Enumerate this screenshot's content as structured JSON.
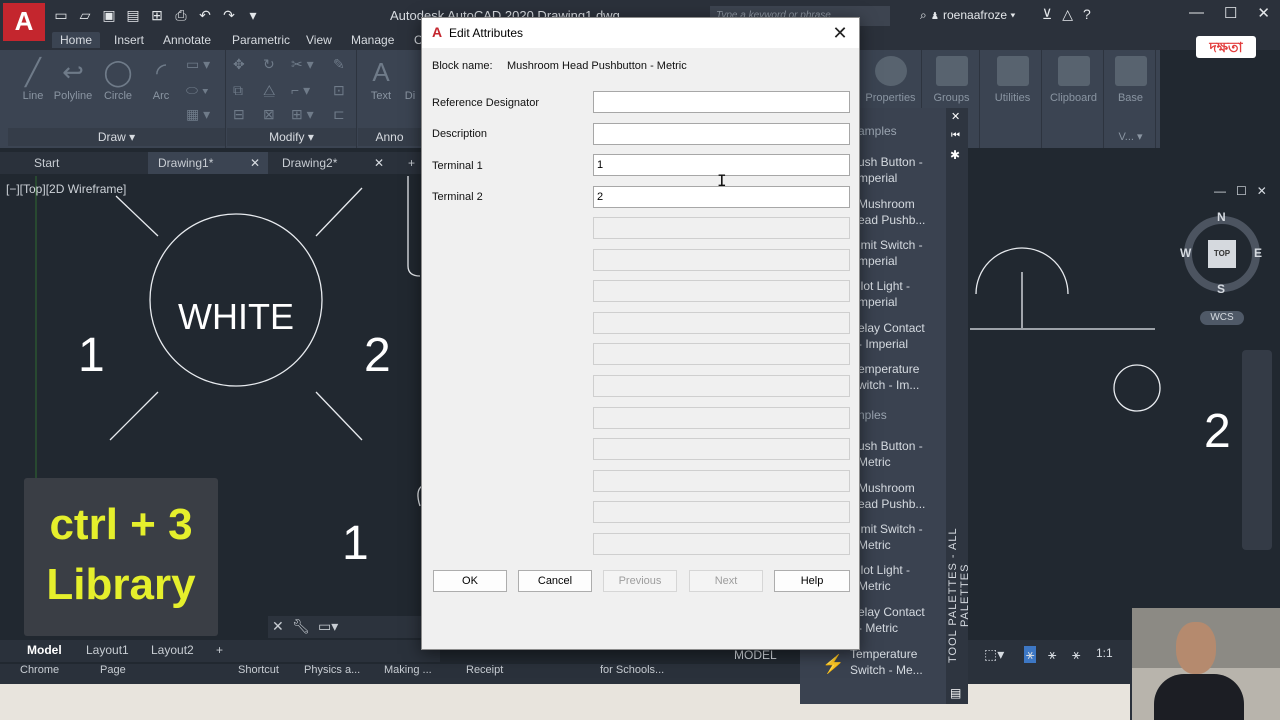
{
  "app": {
    "logo": "A",
    "title": "Autodesk AutoCAD 2020    Drawing1.dwg",
    "search_placeholder": "Type a keyword or phrase",
    "user": "roenaafroze",
    "qat_icons": [
      "new-icon",
      "open-icon",
      "save-icon",
      "saveas-icon",
      "web-icon",
      "print-icon",
      "undo-icon",
      "redo-icon",
      "more-icon"
    ]
  },
  "ribbon": {
    "tabs": [
      "Home",
      "Insert",
      "Annotate",
      "Parametric",
      "View",
      "Manage",
      "O"
    ],
    "active_tab": "Home",
    "draw_tools": [
      "Line",
      "Polyline",
      "Circle",
      "Arc"
    ],
    "draw_panel": "Draw ▾",
    "modify_panel": "Modify ▾",
    "text_tool": "Text",
    "text_tool2": "Di",
    "annotate_panel": "Anno",
    "right_panels": [
      "Properties",
      "Groups",
      "Utilities",
      "Clipboard",
      "Base"
    ],
    "view_label": "V... ▾"
  },
  "doc_tabs": [
    {
      "label": "Start"
    },
    {
      "label": "Drawing1*"
    },
    {
      "label": "Drawing2*"
    }
  ],
  "viewport": {
    "label": "[−][Top][2D Wireframe]",
    "circle_text": "WHITE",
    "labels": [
      "1",
      "2",
      "1",
      "2"
    ]
  },
  "hint": {
    "line1": "ctrl + 3",
    "line2": "Library"
  },
  "layout_tabs": [
    "Model",
    "Layout1",
    "Layout2"
  ],
  "status": {
    "model": "MODEL",
    "scale": "1:1"
  },
  "taskbar_items": [
    "Chrome",
    "Page",
    "Shortcut",
    "Physics a...",
    "Making ...",
    "Receipt",
    "for Schools..."
  ],
  "tool_palette": {
    "title": "TOOL PALETTES - ALL PALETTES",
    "sections": [
      "amples",
      "nples"
    ],
    "items": [
      [
        "ush Button -",
        "mperial"
      ],
      [
        "Mushroom",
        "ead Pushb..."
      ],
      [
        "imit Switch -",
        "mperial"
      ],
      [
        "ilot Light -",
        "mperial"
      ],
      [
        "elay Contact",
        "- Imperial"
      ],
      [
        "emperature",
        "witch - Im..."
      ],
      [
        "ush Button -",
        "Metric"
      ],
      [
        "Mushroom",
        "ead Pushb..."
      ],
      [
        "imit Switch -",
        "Metric"
      ],
      [
        "ilot Light -",
        "Metric"
      ],
      [
        "elay Contact",
        "- Metric"
      ],
      [
        "Temperature",
        "Switch - Me..."
      ]
    ]
  },
  "viewcube": {
    "top": "TOP",
    "n": "N",
    "s": "S",
    "e": "E",
    "w": "W",
    "wcs": "WCS"
  },
  "watermark": "দক্ষতা",
  "dialog": {
    "title": "Edit Attributes",
    "block_name_label": "Block name:",
    "block_name_value": "Mushroom Head Pushbutton - Metric",
    "fields": [
      {
        "label": "Reference Designator",
        "value": ""
      },
      {
        "label": "Description",
        "value": ""
      },
      {
        "label": "Terminal 1",
        "value": "1"
      },
      {
        "label": "Terminal 2",
        "value": "2"
      }
    ],
    "empty_field_count": 11,
    "buttons": {
      "ok": "OK",
      "cancel": "Cancel",
      "previous": "Previous",
      "next": "Next",
      "help": "Help"
    }
  }
}
